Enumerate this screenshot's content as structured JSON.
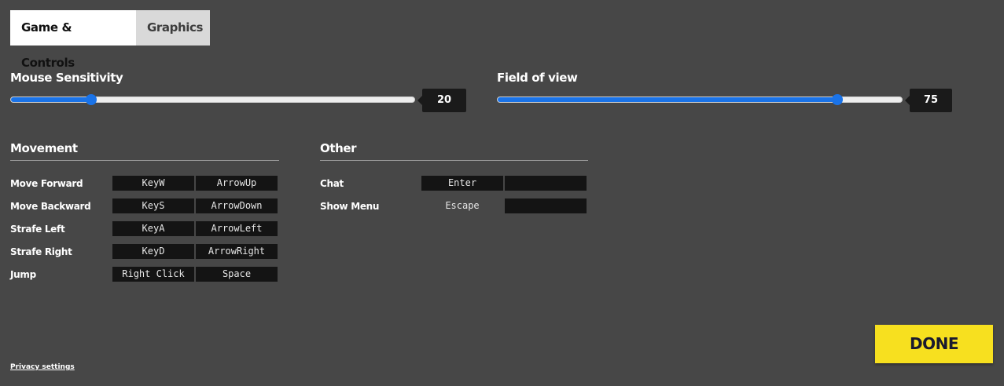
{
  "tabs": [
    {
      "label": "Game & Controls",
      "active": true
    },
    {
      "label": "Graphics",
      "active": false
    }
  ],
  "sliders": {
    "mouse_sensitivity": {
      "label": "Mouse Sensitivity",
      "value": "20",
      "fraction": 0.2
    },
    "field_of_view": {
      "label": "Field of view",
      "value": "75",
      "fraction": 0.84
    }
  },
  "movement": {
    "title": "Movement",
    "rows": [
      {
        "label": "Move Forward",
        "keys": [
          "KeyW",
          "ArrowUp"
        ]
      },
      {
        "label": "Move Backward",
        "keys": [
          "KeyS",
          "ArrowDown"
        ]
      },
      {
        "label": "Strafe Left",
        "keys": [
          "KeyA",
          "ArrowLeft"
        ]
      },
      {
        "label": "Strafe Right",
        "keys": [
          "KeyD",
          "ArrowRight"
        ]
      },
      {
        "label": "Jump",
        "keys": [
          "Right Click",
          "Space"
        ]
      }
    ]
  },
  "other": {
    "title": "Other",
    "rows": [
      {
        "label": "Chat",
        "keys": [
          "Enter",
          ""
        ]
      },
      {
        "label": "Show Menu",
        "keys": [
          "Escape",
          ""
        ]
      }
    ]
  },
  "done_label": "DONE",
  "privacy_label": "Privacy settings",
  "colors": {
    "accent": "#1a73e8",
    "done": "#f7e01f",
    "background": "#474747"
  }
}
